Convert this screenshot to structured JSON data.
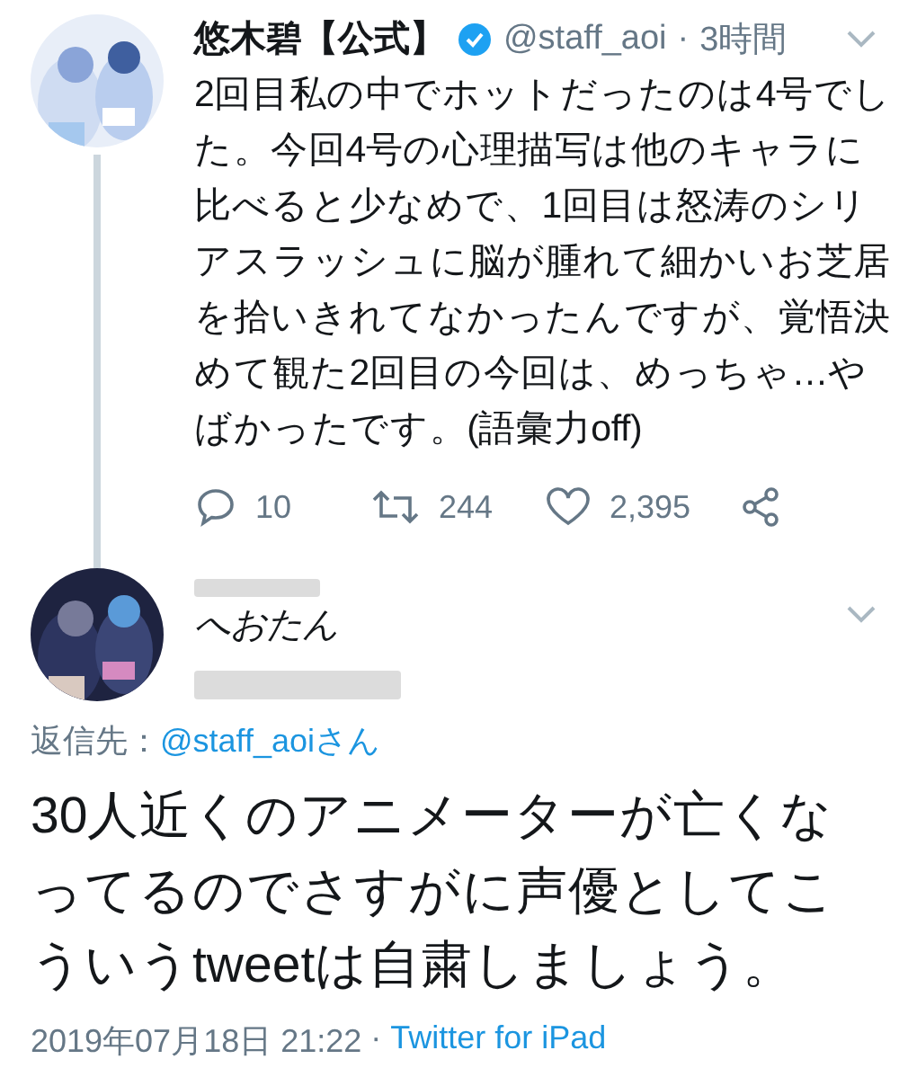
{
  "tweet": {
    "author": {
      "name": "悠木碧【公式】",
      "verified": true,
      "handle": "@staff_aoi",
      "separator": "·",
      "time": "3時間"
    },
    "text_lines": [
      "2回目私の中でホットだったのは4号でし",
      "た。今回4号の心理描写は他のキャラに",
      "比べると少なめで、1回目は怒涛のシリ",
      "アスラッシュに脳が腫れて細かいお芝居",
      "を拾いきれてなかったんですが、覚悟決",
      "めて観た2回目の今回は、めっちゃ…や",
      "ばかったです。(語彙力off)"
    ],
    "actions": [
      {
        "kind": "reply",
        "count": "10"
      },
      {
        "kind": "retweet",
        "count": "244"
      },
      {
        "kind": "like",
        "count": "2,395"
      },
      {
        "kind": "share"
      }
    ]
  },
  "reply": {
    "author": {
      "name": "へおたん",
      "handle_redacted": true
    },
    "reply_to_label": "返信先：",
    "reply_to_handle": "@staff_aoiさん",
    "text_lines": [
      "30人近くのアニメーターが亡くな",
      "ってるのでさすがに声優としてこ",
      "ういうtweetは自粛しましょう。"
    ],
    "timestamp": "2019年07月18日 21:22",
    "separator": "·",
    "source": "Twitter for iPad"
  }
}
